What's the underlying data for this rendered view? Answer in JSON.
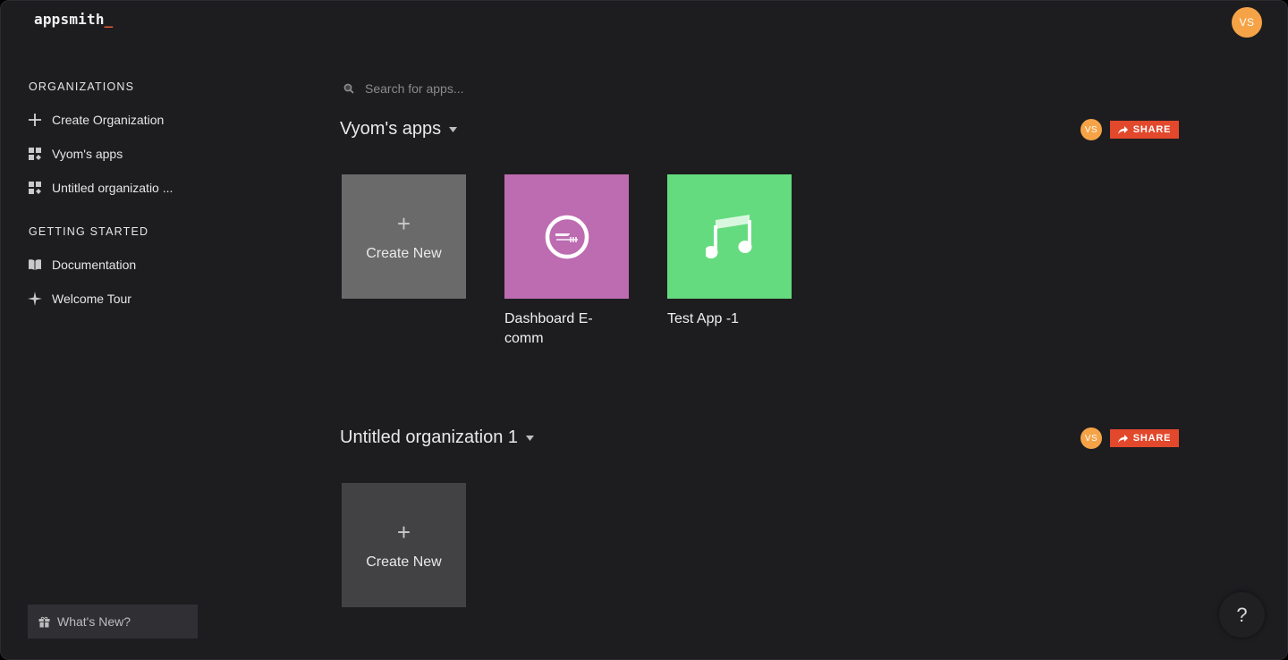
{
  "brand": {
    "name": "appsmith",
    "cursor": "_",
    "accent": "#e2592e"
  },
  "user": {
    "initials": "VS",
    "avatar_color": "#f5a346"
  },
  "sidebar": {
    "organizations_title": "ORGANIZATIONS",
    "org_items": [
      {
        "label": "Create Organization",
        "icon": "plus-icon"
      },
      {
        "label": "Vyom's apps",
        "icon": "grid-icon"
      },
      {
        "label": "Untitled organizatio ...",
        "icon": "grid-icon"
      }
    ],
    "getting_started_title": "GETTING STARTED",
    "help_items": [
      {
        "label": "Documentation",
        "icon": "book-icon"
      },
      {
        "label": "Welcome Tour",
        "icon": "sparkle-icon"
      }
    ],
    "whats_new": "What's New?"
  },
  "search": {
    "placeholder": "Search for apps..."
  },
  "organizations": [
    {
      "name": "Vyom's apps",
      "member_initials": "VS",
      "share_label": "SHARE",
      "create_label": "Create New",
      "apps": [
        {
          "name": "Dashboard E-comm",
          "color": "#bd6cb1",
          "icon": "restaurant-icon"
        },
        {
          "name": "Test App -1",
          "color": "#64db7e",
          "icon": "music-note-icon"
        }
      ]
    },
    {
      "name": "Untitled organization 1",
      "member_initials": "VS",
      "share_label": "SHARE",
      "create_label": "Create New",
      "apps": []
    }
  ],
  "help_button": "?",
  "colors": {
    "background": "#1d1d20",
    "share": "#e2482c",
    "create_card_1": "#6a6a6a",
    "create_card_2": "#424244"
  }
}
